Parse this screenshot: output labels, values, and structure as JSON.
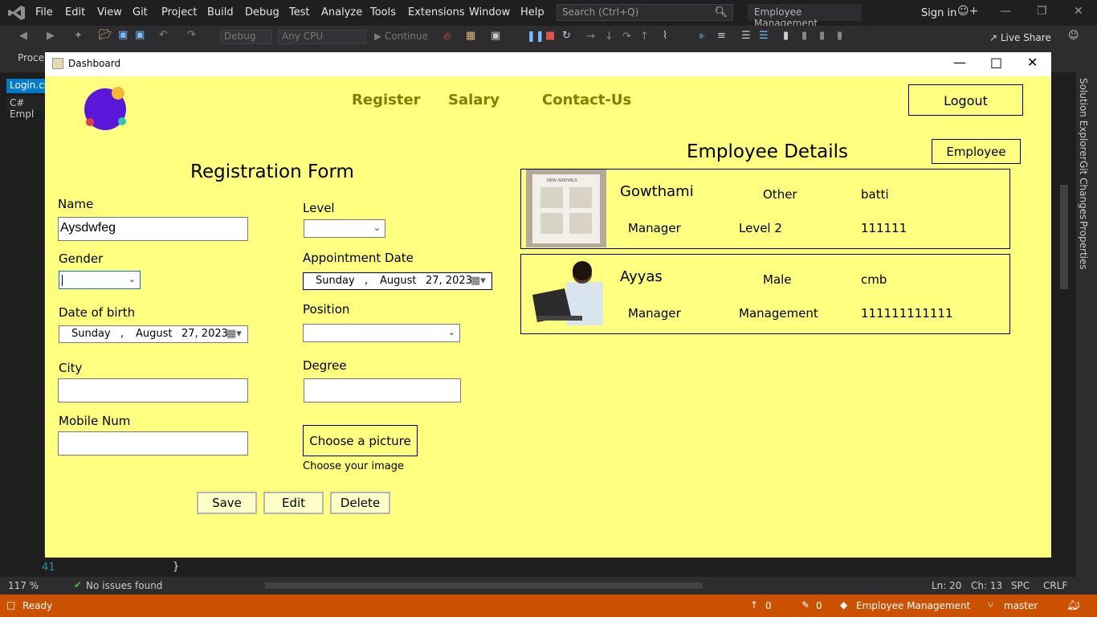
{
  "vs": {
    "menu": [
      "File",
      "Edit",
      "View",
      "Git",
      "Project",
      "Build",
      "Debug",
      "Test",
      "Analyze",
      "Tools",
      "Extensions",
      "Window",
      "Help"
    ],
    "search_placeholder": "Search (Ctrl+Q)",
    "project_title": "Employee Management",
    "sign_in": "Sign in",
    "config_combo": "Debug",
    "platform_combo": "Any CPU",
    "continue_label": "Continue",
    "live_share": "Live Share",
    "process_label": "Proce",
    "tab_login": "Login.cs",
    "tab_empl": "Empl",
    "line_number": "41",
    "code_brace": "}",
    "right_tabs": [
      "Solution Explorer",
      "Git Changes",
      "Properties"
    ],
    "status": {
      "zoom": "117 %",
      "issues": "No issues found",
      "ln": "Ln: 20",
      "ch": "Ch: 13",
      "spc": "SPC",
      "crlf": "CRLF",
      "ready": "Ready",
      "up_count": "0",
      "pencil_count": "0",
      "project": "Employee Management",
      "branch": "master",
      "notif": "1"
    }
  },
  "dashboard": {
    "window_title": "Dashboard",
    "nav": {
      "register": "Register",
      "salary": "Salary",
      "contact": "Contact-Us"
    },
    "logout_label": "Logout",
    "form_title": "Registration Form",
    "labels": {
      "name": "Name",
      "gender": "Gender",
      "dob": "Date of birth",
      "city": "City",
      "mobile": "Mobile Num",
      "level": "Level",
      "appointment": "Appointment Date",
      "position": "Position",
      "degree": "Degree"
    },
    "values": {
      "name": "Aysdwfeg",
      "gender": "",
      "city": "",
      "mobile": "",
      "level": "",
      "position": "",
      "degree": ""
    },
    "dob": {
      "day": "Sunday",
      "sep": ",",
      "month": "August",
      "date": "27, 2023"
    },
    "appointment": {
      "day": "Sunday",
      "sep": ",",
      "month": "August",
      "date": "27, 2023"
    },
    "choose_picture_label": "Choose a picture",
    "choose_hint": "Choose your image",
    "buttons": {
      "save": "Save",
      "edit": "Edit",
      "delete": "Delete"
    },
    "details_title": "Employee Details",
    "employee_button": "Employee",
    "employees": [
      {
        "name": "Gowthami",
        "gender": "Other",
        "city": "batti",
        "position": "Manager",
        "level": "Level 2",
        "mobile": "111111"
      },
      {
        "name": "Ayyas",
        "gender": "Male",
        "city": "cmb",
        "position": "Manager",
        "level": "Management",
        "mobile": "111111111111"
      }
    ],
    "photo_caption": "NEW ARRIVALS"
  }
}
